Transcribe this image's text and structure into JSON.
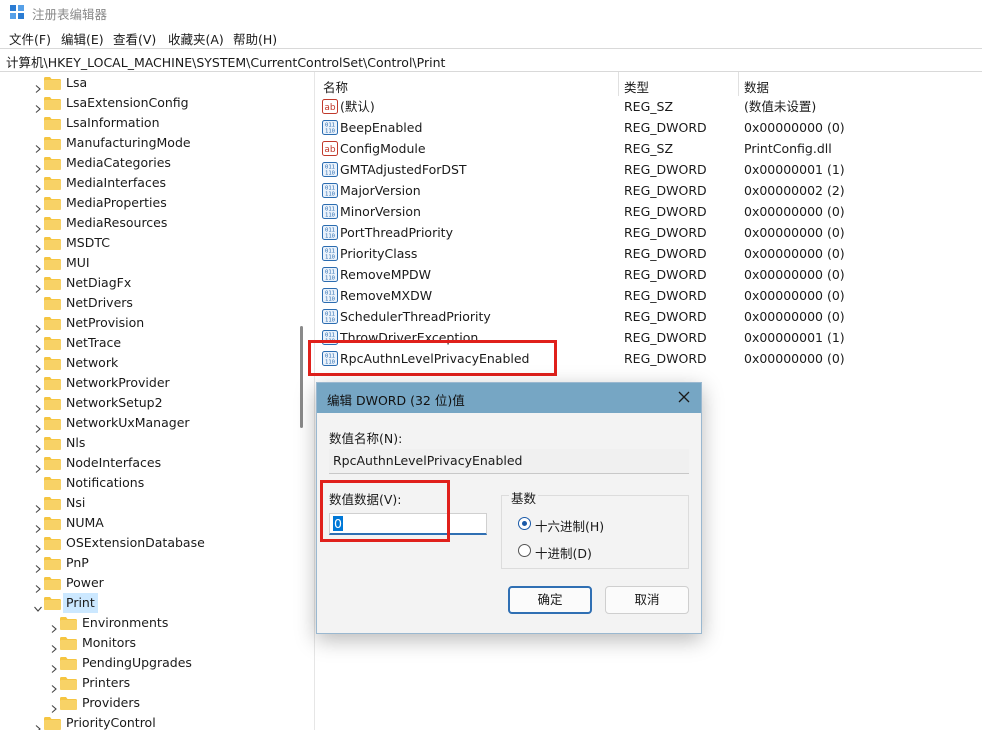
{
  "window": {
    "title": "注册表编辑器"
  },
  "menu": [
    "文件(F)",
    "编辑(E)",
    "查看(V)",
    "收藏夹(A)",
    "帮助(H)"
  ],
  "address": "计算机\\HKEY_LOCAL_MACHINE\\SYSTEM\\CurrentControlSet\\Control\\Print",
  "tree": {
    "items": [
      {
        "label": "Lsa",
        "expandable": true
      },
      {
        "label": "LsaExtensionConfig",
        "expandable": true
      },
      {
        "label": "LsaInformation",
        "expandable": false
      },
      {
        "label": "ManufacturingMode",
        "expandable": true
      },
      {
        "label": "MediaCategories",
        "expandable": true
      },
      {
        "label": "MediaInterfaces",
        "expandable": true
      },
      {
        "label": "MediaProperties",
        "expandable": true
      },
      {
        "label": "MediaResources",
        "expandable": true
      },
      {
        "label": "MSDTC",
        "expandable": true
      },
      {
        "label": "MUI",
        "expandable": true
      },
      {
        "label": "NetDiagFx",
        "expandable": true
      },
      {
        "label": "NetDrivers",
        "expandable": false
      },
      {
        "label": "NetProvision",
        "expandable": true
      },
      {
        "label": "NetTrace",
        "expandable": true
      },
      {
        "label": "Network",
        "expandable": true
      },
      {
        "label": "NetworkProvider",
        "expandable": true
      },
      {
        "label": "NetworkSetup2",
        "expandable": true
      },
      {
        "label": "NetworkUxManager",
        "expandable": true
      },
      {
        "label": "Nls",
        "expandable": true
      },
      {
        "label": "NodeInterfaces",
        "expandable": true
      },
      {
        "label": "Notifications",
        "expandable": false
      },
      {
        "label": "Nsi",
        "expandable": true
      },
      {
        "label": "NUMA",
        "expandable": true
      },
      {
        "label": "OSExtensionDatabase",
        "expandable": true
      },
      {
        "label": "PnP",
        "expandable": true
      },
      {
        "label": "Power",
        "expandable": true
      },
      {
        "label": "Print",
        "expandable": true,
        "expanded": true,
        "selected": true
      },
      {
        "label": "Environments",
        "expandable": true,
        "child": true
      },
      {
        "label": "Monitors",
        "expandable": true,
        "child": true
      },
      {
        "label": "PendingUpgrades",
        "expandable": true,
        "child": true
      },
      {
        "label": "Printers",
        "expandable": true,
        "child": true
      },
      {
        "label": "Providers",
        "expandable": true,
        "child": true
      },
      {
        "label": "PriorityControl",
        "expandable": true
      }
    ]
  },
  "columns": {
    "name": "名称",
    "type": "类型",
    "data": "数据"
  },
  "values": [
    {
      "name": "(默认)",
      "type": "REG_SZ",
      "data": "(数值未设置)",
      "icon": "string-icon"
    },
    {
      "name": "BeepEnabled",
      "type": "REG_DWORD",
      "data": "0x00000000 (0)",
      "icon": "dword-icon"
    },
    {
      "name": "ConfigModule",
      "type": "REG_SZ",
      "data": "PrintConfig.dll",
      "icon": "string-icon"
    },
    {
      "name": "GMTAdjustedForDST",
      "type": "REG_DWORD",
      "data": "0x00000001 (1)",
      "icon": "dword-icon"
    },
    {
      "name": "MajorVersion",
      "type": "REG_DWORD",
      "data": "0x00000002 (2)",
      "icon": "dword-icon"
    },
    {
      "name": "MinorVersion",
      "type": "REG_DWORD",
      "data": "0x00000000 (0)",
      "icon": "dword-icon"
    },
    {
      "name": "PortThreadPriority",
      "type": "REG_DWORD",
      "data": "0x00000000 (0)",
      "icon": "dword-icon"
    },
    {
      "name": "PriorityClass",
      "type": "REG_DWORD",
      "data": "0x00000000 (0)",
      "icon": "dword-icon"
    },
    {
      "name": "RemoveMPDW",
      "type": "REG_DWORD",
      "data": "0x00000000 (0)",
      "icon": "dword-icon"
    },
    {
      "name": "RemoveMXDW",
      "type": "REG_DWORD",
      "data": "0x00000000 (0)",
      "icon": "dword-icon"
    },
    {
      "name": "SchedulerThreadPriority",
      "type": "REG_DWORD",
      "data": "0x00000000 (0)",
      "icon": "dword-icon"
    },
    {
      "name": "ThrowDriverException",
      "type": "REG_DWORD",
      "data": "0x00000001 (1)",
      "icon": "dword-icon"
    },
    {
      "name": "RpcAuthnLevelPrivacyEnabled",
      "type": "REG_DWORD",
      "data": "0x00000000 (0)",
      "icon": "dword-icon"
    }
  ],
  "dialog": {
    "title": "编辑 DWORD (32 位)值",
    "name_label": "数值名称(N):",
    "name_value": "RpcAuthnLevelPrivacyEnabled",
    "data_label": "数值数据(V):",
    "data_value": "0",
    "base_label": "基数",
    "hex_label": "十六进制(H)",
    "dec_label": "十进制(D)",
    "base_selected": "hex",
    "ok_label": "确定",
    "cancel_label": "取消"
  },
  "colors": {
    "highlight": "#e0201b",
    "dialog_title": "#76a6c4",
    "folder": "#f5c542",
    "selection": "#cce8ff"
  }
}
